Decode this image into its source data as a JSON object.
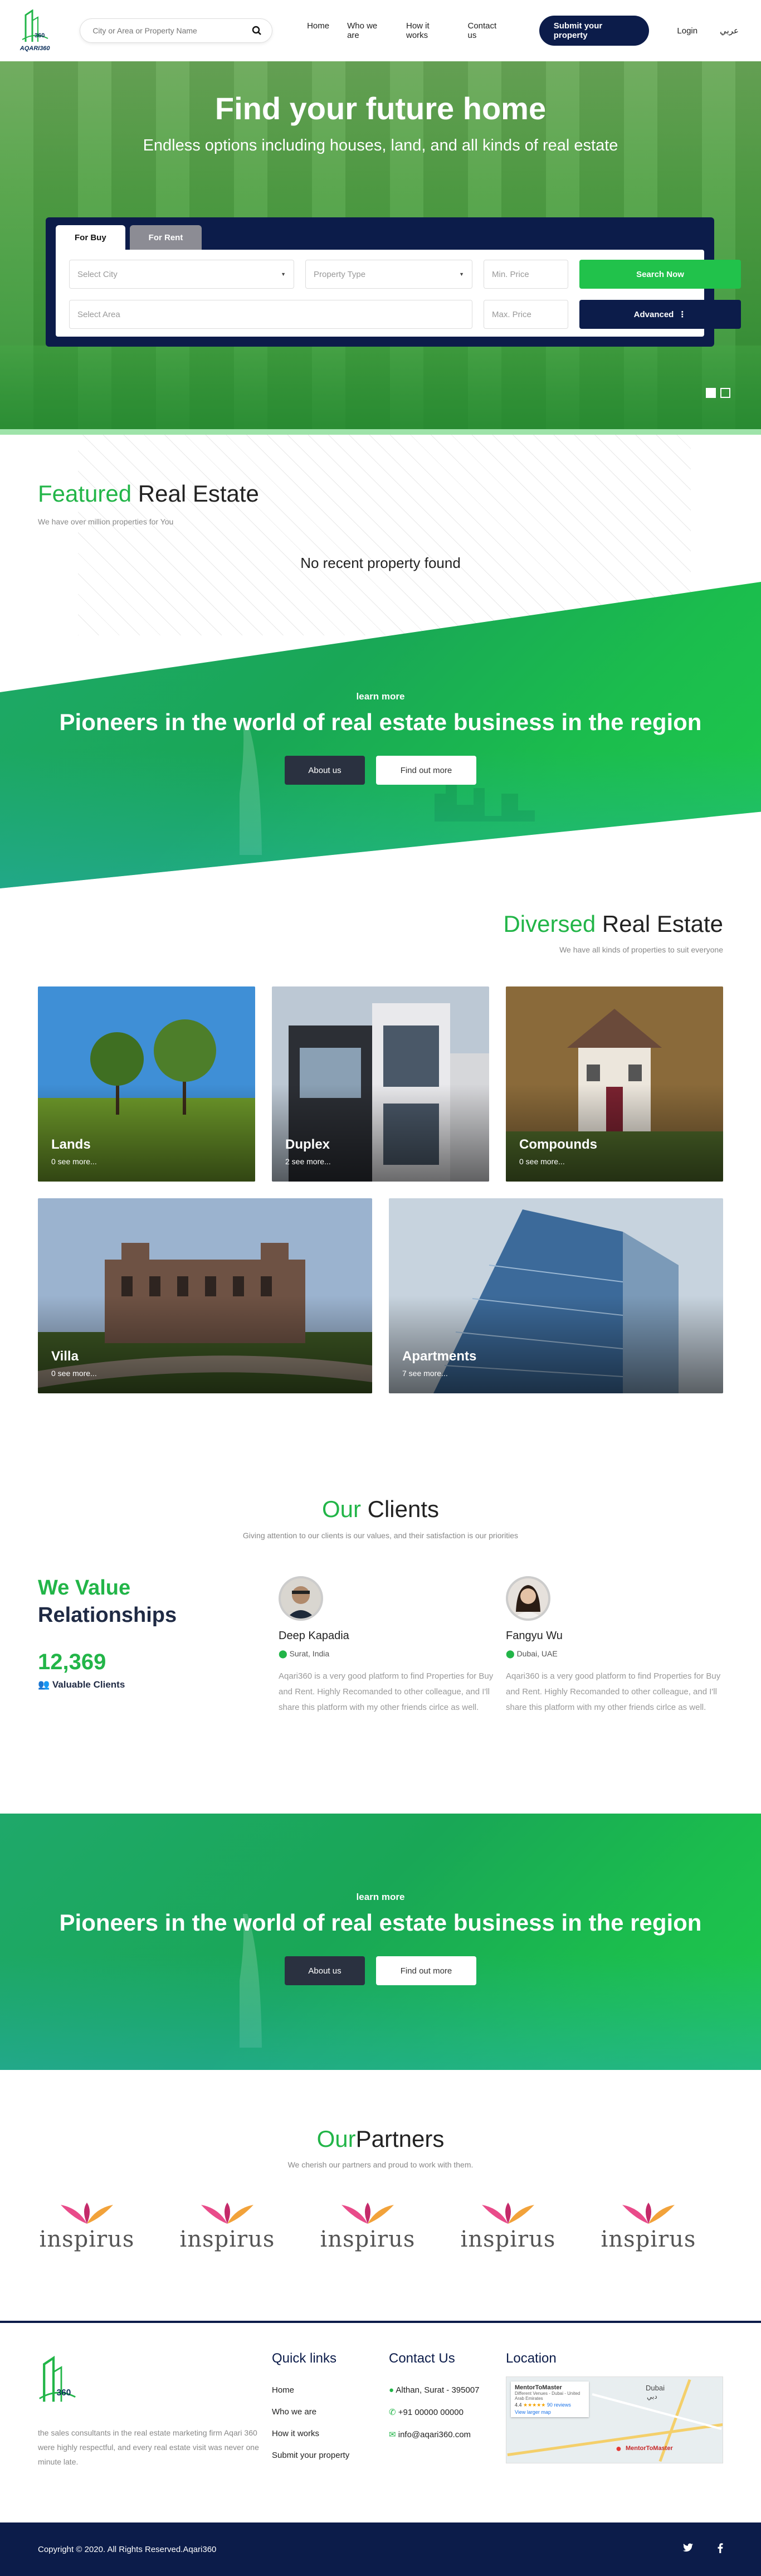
{
  "header": {
    "logo_text": "AQARI360",
    "search_placeholder": "City or Area or Property Name",
    "nav": [
      "Home",
      "Who we are",
      "How it works",
      "Contact us"
    ],
    "submit_label": "Submit your property",
    "login_label": "Login",
    "lang_label": "عربي"
  },
  "hero": {
    "title": "Find your future home",
    "subtitle": "Endless options including houses, land, and all kinds of real estate",
    "tabs": [
      "For Buy",
      "For Rent"
    ],
    "city_placeholder": "Select City",
    "type_placeholder": "Property Type",
    "min_price": "Min. Price",
    "max_price": "Max. Price",
    "area_placeholder": "Select Area",
    "search_label": "Search Now",
    "advanced_label": "Advanced"
  },
  "featured": {
    "title_green": "Featured",
    "title_dark": "Real Estate",
    "subtitle": "We have over million properties for You",
    "empty": "No recent property found"
  },
  "pioneers": {
    "kicker": "learn more",
    "title": "Pioneers in the world of real estate business in the region",
    "about_label": "About us",
    "more_label": "Find out more"
  },
  "diversed": {
    "title_green": "Diversed",
    "title_dark": "Real Estate",
    "subtitle": "We have all kinds of properties to suit everyone",
    "tiles": [
      {
        "name": "Lands",
        "count": "0 see more..."
      },
      {
        "name": "Duplex",
        "count": "2 see more..."
      },
      {
        "name": "Compounds",
        "count": "0 see more..."
      },
      {
        "name": "Villa",
        "count": "0 see more..."
      },
      {
        "name": "Apartments",
        "count": "7 see more..."
      }
    ]
  },
  "clients": {
    "title_green": "Our",
    "title_dark": "Clients",
    "subtitle": "Giving attention to our clients is our values, and their satisfaction is our priorities",
    "value_line1": "We Value",
    "value_line2": "Relationships",
    "count": "12,369",
    "count_label": "Valuable Clients",
    "testimonials": [
      {
        "name": "Deep Kapadia",
        "location": "Surat, India",
        "text": "Aqari360 is a very good platform to find Properties for Buy and Rent. Highly Recomanded to other colleague, and I'll share this platform with my other friends cirlce as well."
      },
      {
        "name": "Fangyu Wu",
        "location": "Dubai, UAE",
        "text": "Aqari360 is a very good platform to find Properties for Buy and Rent. Highly Recomanded to other colleague, and I'll share this platform with my other friends cirlce as well."
      }
    ]
  },
  "partners": {
    "title_green": "Our",
    "title_dark": "Partners",
    "subtitle": "We cherish our partners and proud to work with them.",
    "logos": [
      "inspirus",
      "inspirus",
      "inspirus",
      "inspirus",
      "inspirus"
    ]
  },
  "footer": {
    "description": "the sales consultants in the real estate marketing firm Aqari 360 were highly respectful, and every real estate visit was never one minute late.",
    "quick_title": "Quick links",
    "quick_links": [
      "Home",
      "Who we are",
      "How it works",
      "Submit your property"
    ],
    "contact_title": "Contact Us",
    "address": "Althan, Surat - 395007",
    "phone": "+91 00000 00000",
    "email": "info@aqari360.com",
    "location_title": "Location",
    "map_place": "MentorToMaster",
    "map_address": "Different Venues - Dubai - United Arab Emirates",
    "map_rating": "4.4",
    "map_reviews": "90 reviews",
    "map_link": "View larger map",
    "map_city": "Dubai",
    "map_city_ar": "دبي",
    "map_pin_label": "MentorToMaster",
    "copyright": "Copyright © 2020. All Rights Reserved.Aqari360",
    "social": [
      "twitter-icon",
      "facebook-icon"
    ]
  },
  "colors": {
    "green": "#22b548",
    "navy": "#0c1c4a",
    "button_green": "#21c24b"
  }
}
